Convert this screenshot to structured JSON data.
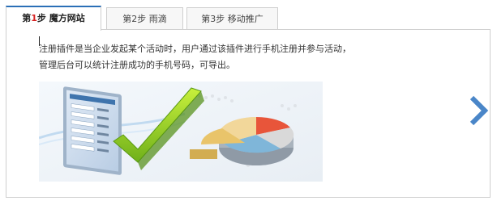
{
  "tabs": [
    {
      "prefix": "第",
      "num": "1",
      "rest": "步 魔方网站",
      "active": true
    },
    {
      "label": "第2步 雨滴",
      "active": false
    },
    {
      "label": "第3步 移动推广",
      "active": false
    }
  ],
  "content": {
    "line1": "注册插件是当企业发起某个活动时，用户通过该插件进行手机注册并参与活动，",
    "line2": "管理后台可以统计注册成功的手机号码，可导出。"
  },
  "icons": {
    "next": "chevron-right-icon"
  },
  "colors": {
    "accent": "#2a6fb7",
    "tab_number": "#d62020",
    "arrow": "#4a86c8"
  }
}
